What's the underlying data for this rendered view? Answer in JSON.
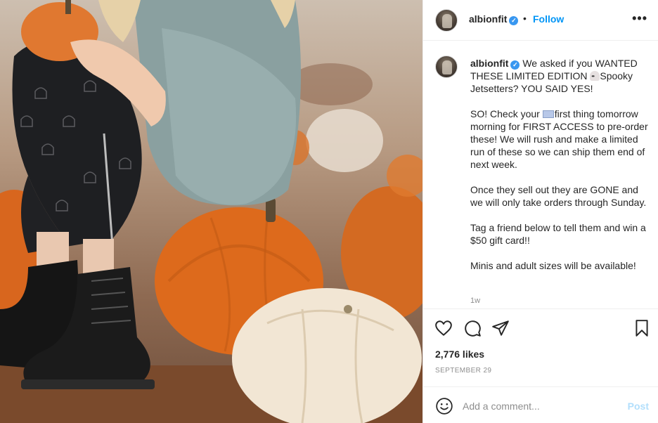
{
  "post": {
    "image_alt": "Child sitting on pumpkins wearing ghost-print pants and black boots",
    "header": {
      "username": "albionfit",
      "verified_icon": "verified-badge-icon",
      "separator": "•",
      "follow_label": "Follow",
      "more_label": "•••"
    },
    "caption": {
      "username": "albionfit",
      "para1": "We asked if you WANTED THESE LIMITED EDITION",
      "para1b": "Spooky Jetsetters? YOU SAID YES!",
      "para2a": "SO! Check your",
      "para2b": "first thing tomorrow morning for FIRST ACCESS to pre-order these! We will rush and make a limited run of these so we can ship them end of next week.",
      "para3": "Once they sell out they are GONE and we will only take orders through Sunday.",
      "para4": "Tag a friend below to tell them and win a $50 gift card!!",
      "para5": "Minis and adult sizes will be available!",
      "age": "1w"
    },
    "actions": {
      "like_icon": "heart-icon",
      "comment_icon": "comment-icon",
      "share_icon": "send-icon",
      "save_icon": "bookmark-icon"
    },
    "likes": "2,776 likes",
    "date": "SEPTEMBER 29",
    "add_comment": {
      "emoji_icon": "smiley-icon",
      "placeholder": "Add a comment...",
      "post_label": "Post"
    }
  },
  "colors": {
    "link_blue": "#0095f6",
    "post_disabled": "#b2dffc",
    "muted_text": "#8e8e8e",
    "divider": "#efefef"
  }
}
